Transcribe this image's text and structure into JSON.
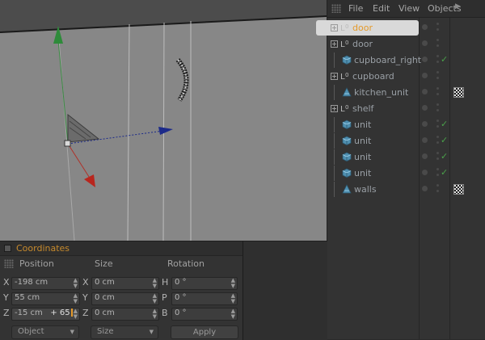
{
  "object_manager": {
    "menu": [
      "File",
      "Edit",
      "View",
      "Objects"
    ],
    "objects": [
      {
        "name": "door",
        "type": "null",
        "selected": true,
        "expander": true,
        "depth": 0,
        "check": false,
        "tag": false
      },
      {
        "name": "door",
        "type": "null",
        "selected": false,
        "expander": true,
        "depth": 0,
        "check": false,
        "tag": false
      },
      {
        "name": "cupboard_right",
        "type": "polygon",
        "selected": false,
        "expander": false,
        "depth": 1,
        "check": true,
        "tag": false
      },
      {
        "name": "cupboard",
        "type": "null",
        "selected": false,
        "expander": true,
        "depth": 0,
        "check": false,
        "tag": false
      },
      {
        "name": "kitchen_unit",
        "type": "polygon-alt",
        "selected": false,
        "expander": false,
        "depth": 1,
        "check": false,
        "tag": true
      },
      {
        "name": "shelf",
        "type": "null",
        "selected": false,
        "expander": true,
        "depth": 0,
        "check": false,
        "tag": false
      },
      {
        "name": "unit",
        "type": "polygon",
        "selected": false,
        "expander": false,
        "depth": 1,
        "check": true,
        "tag": false
      },
      {
        "name": "unit",
        "type": "polygon",
        "selected": false,
        "expander": false,
        "depth": 1,
        "check": true,
        "tag": false
      },
      {
        "name": "unit",
        "type": "polygon",
        "selected": false,
        "expander": false,
        "depth": 1,
        "check": true,
        "tag": false
      },
      {
        "name": "unit",
        "type": "polygon",
        "selected": false,
        "expander": false,
        "depth": 1,
        "check": true,
        "tag": false
      },
      {
        "name": "walls",
        "type": "polygon-alt",
        "selected": false,
        "expander": false,
        "depth": 1,
        "check": false,
        "tag": true
      }
    ]
  },
  "coordinates": {
    "title": "Coordinates",
    "headers": {
      "position": "Position",
      "size": "Size",
      "rotation": "Rotation"
    },
    "position": {
      "x": "-198 cm",
      "y": "55 cm",
      "z": "-15 cm",
      "z_insert": "+ 65"
    },
    "size": {
      "x": "0 cm",
      "y": "0 cm",
      "z": "0 cm"
    },
    "rotation": {
      "h": "0 °",
      "p": "0 °",
      "b": "0 °"
    },
    "axis_labels": {
      "x": "X",
      "y": "Y",
      "z": "Z",
      "h": "H",
      "p": "P",
      "b": "B"
    },
    "mode_dropdown": "Object",
    "size_dropdown": "Size",
    "apply_label": "Apply"
  },
  "colors": {
    "selected_text": "#e59a2b",
    "axis_x": "#c0392b",
    "axis_y": "#2e8b3a",
    "axis_z": "#1c2a8a",
    "check": "#4aa04a"
  }
}
